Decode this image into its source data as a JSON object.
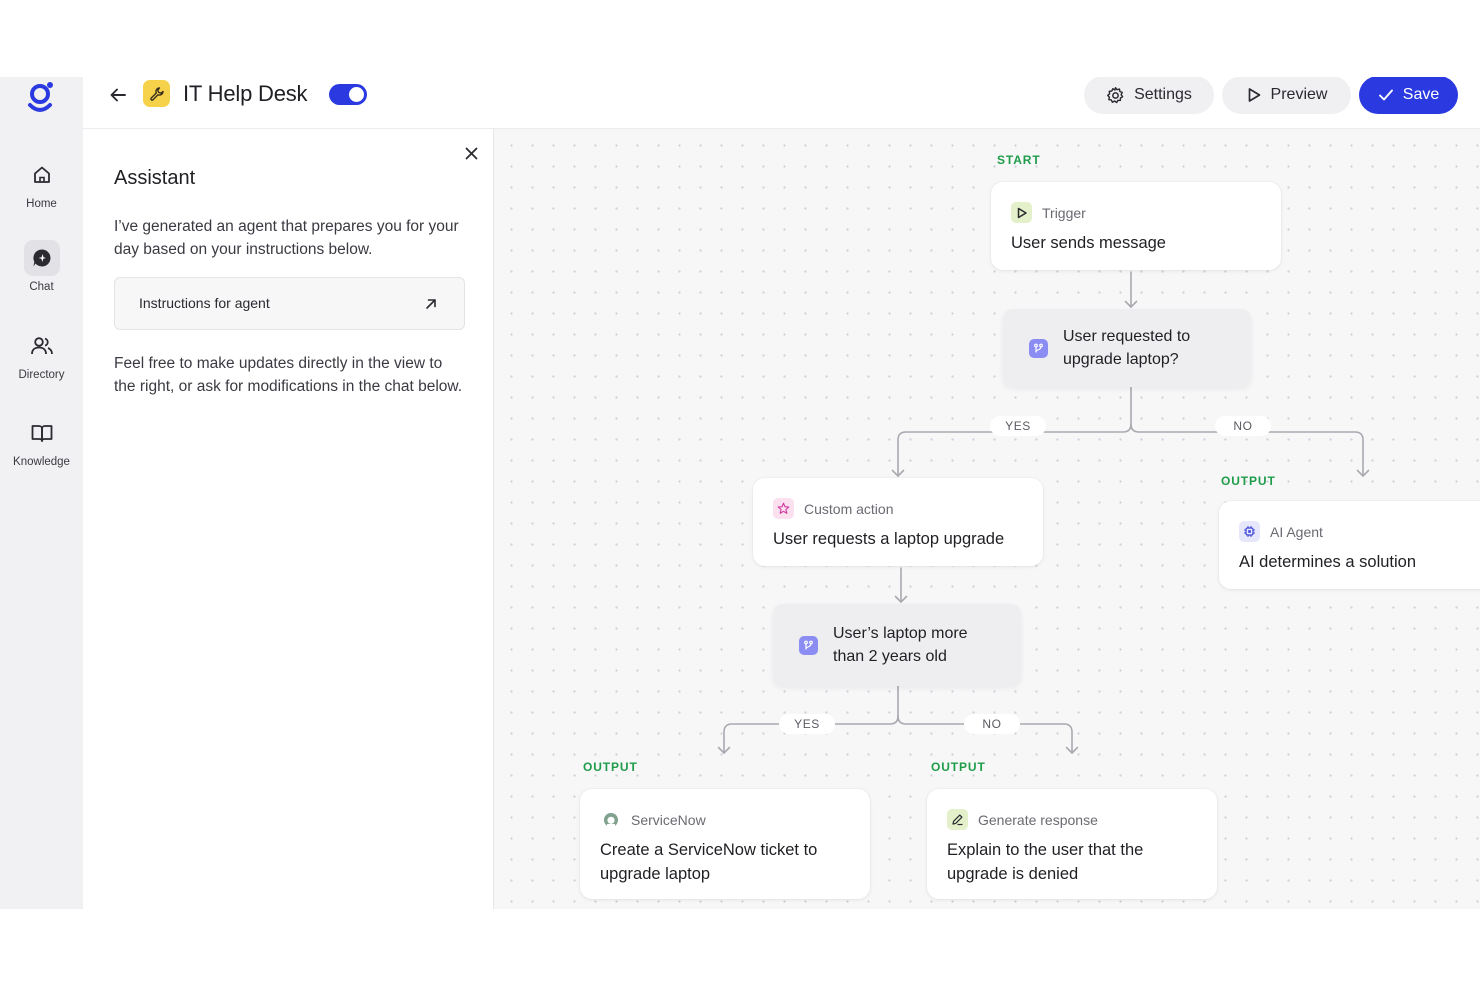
{
  "nav": {
    "items": [
      {
        "label": "Home",
        "icon": "home-icon"
      },
      {
        "label": "Chat",
        "icon": "chat-icon"
      },
      {
        "label": "Directory",
        "icon": "users-icon"
      },
      {
        "label": "Knowledge",
        "icon": "book-icon"
      }
    ]
  },
  "header": {
    "title": "IT Help Desk",
    "enabled": true,
    "settings_label": "Settings",
    "preview_label": "Preview",
    "save_label": "Save"
  },
  "assistant": {
    "title": "Assistant",
    "intro": "I’ve generated an agent that prepares you for your day based on your instructions below.",
    "instructions_label": "Instructions for agent",
    "outro": "Feel free to make updates directly in the view to the right, or ask for modifications in the chat below."
  },
  "flow": {
    "start_tag": "START",
    "trigger": {
      "kind": "Trigger",
      "text": "User sends message"
    },
    "condition1": {
      "text": "User requested to upgrade laptop?"
    },
    "yes1": "YES",
    "no1": "NO",
    "output_ai_tag": "OUTPUT",
    "ai_agent": {
      "kind": "AI Agent",
      "text": "AI determines a solution"
    },
    "custom_action": {
      "kind": "Custom action",
      "text": "User requests a laptop upgrade"
    },
    "condition2": {
      "text": "User’s laptop more than 2 years old"
    },
    "yes2": "YES",
    "no2": "NO",
    "output_sn_tag": "OUTPUT",
    "servicenow": {
      "kind": "ServiceNow",
      "text": "Create a ServiceNow ticket to upgrade laptop"
    },
    "output_gen_tag": "OUTPUT",
    "generate": {
      "kind": "Generate response",
      "text": "Explain to the user that the upgrade is denied"
    }
  },
  "colors": {
    "accent": "#2b3ae0",
    "output_tag": "#1f9c4a",
    "app_badge": "#f6d24a",
    "condition_icon": "#8c8df2"
  }
}
